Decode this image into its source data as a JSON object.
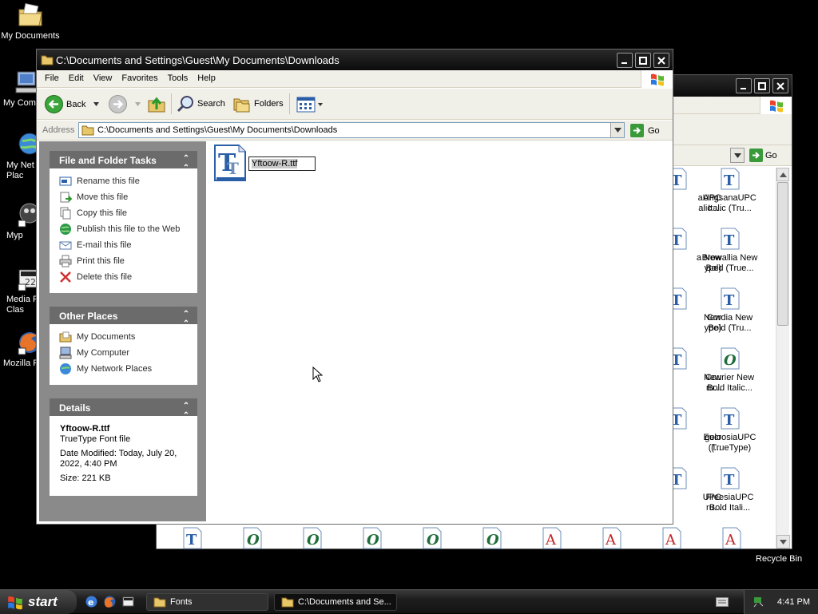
{
  "desktop": {
    "icons": [
      {
        "label": "My Documents"
      },
      {
        "label": "My Com"
      },
      {
        "label": "My Net\nPlac"
      },
      {
        "label": "Myp"
      },
      {
        "label": "Media F\nClas"
      },
      {
        "label": "Mozilla F"
      }
    ],
    "recycle_bin": "Recycle Bin"
  },
  "fonts_window": {
    "address_go": "Go",
    "icons": [
      {
        "label": "aUPC\nalic ..."
      },
      {
        "label": "AngsanaUPC\nItalic (Tru..."
      },
      {
        "label": "a New\nype)"
      },
      {
        "label": "Browallia New\nBold (True..."
      },
      {
        "label": "New\nype)"
      },
      {
        "label": "Cordia New\nBold (Tru..."
      },
      {
        "label": "New\nru..."
      },
      {
        "label": "Courier New\nBold Italic..."
      },
      {
        "label": "gelo\n(..."
      },
      {
        "label": "EucrosiaUPC\n(TrueType)"
      },
      {
        "label": "UPC\nru..."
      },
      {
        "label": "FreesiaUPC\nBold Itali..."
      }
    ]
  },
  "main_window": {
    "title": "C:\\Documents and Settings\\Guest\\My Documents\\Downloads",
    "menu": [
      "File",
      "Edit",
      "View",
      "Favorites",
      "Tools",
      "Help"
    ],
    "toolbar": {
      "back": "Back",
      "search": "Search",
      "folders": "Folders"
    },
    "address": {
      "label": "Address",
      "value": "C:\\Documents and Settings\\Guest\\My Documents\\Downloads",
      "go": "Go"
    },
    "file_folder_tasks": {
      "title": "File and Folder Tasks",
      "items": [
        "Rename this file",
        "Move this file",
        "Copy this file",
        "Publish this file to the Web",
        "E-mail this file",
        "Print this file",
        "Delete this file"
      ]
    },
    "other_places": {
      "title": "Other Places",
      "items": [
        "My Documents",
        "My Computer",
        "My Network Places"
      ]
    },
    "details": {
      "title": "Details",
      "name": "Yftoow-R.ttf",
      "type": "TrueType Font file",
      "modified": "Date Modified: Today, July 20, 2022, 4:40 PM",
      "size": "Size: 221 KB"
    },
    "file": {
      "name": "Yftoow-R.ttf"
    }
  },
  "taskbar": {
    "start": "start",
    "buttons": [
      {
        "label": "Fonts"
      },
      {
        "label": "C:\\Documents and Se..."
      }
    ],
    "clock": "4:41 PM"
  }
}
